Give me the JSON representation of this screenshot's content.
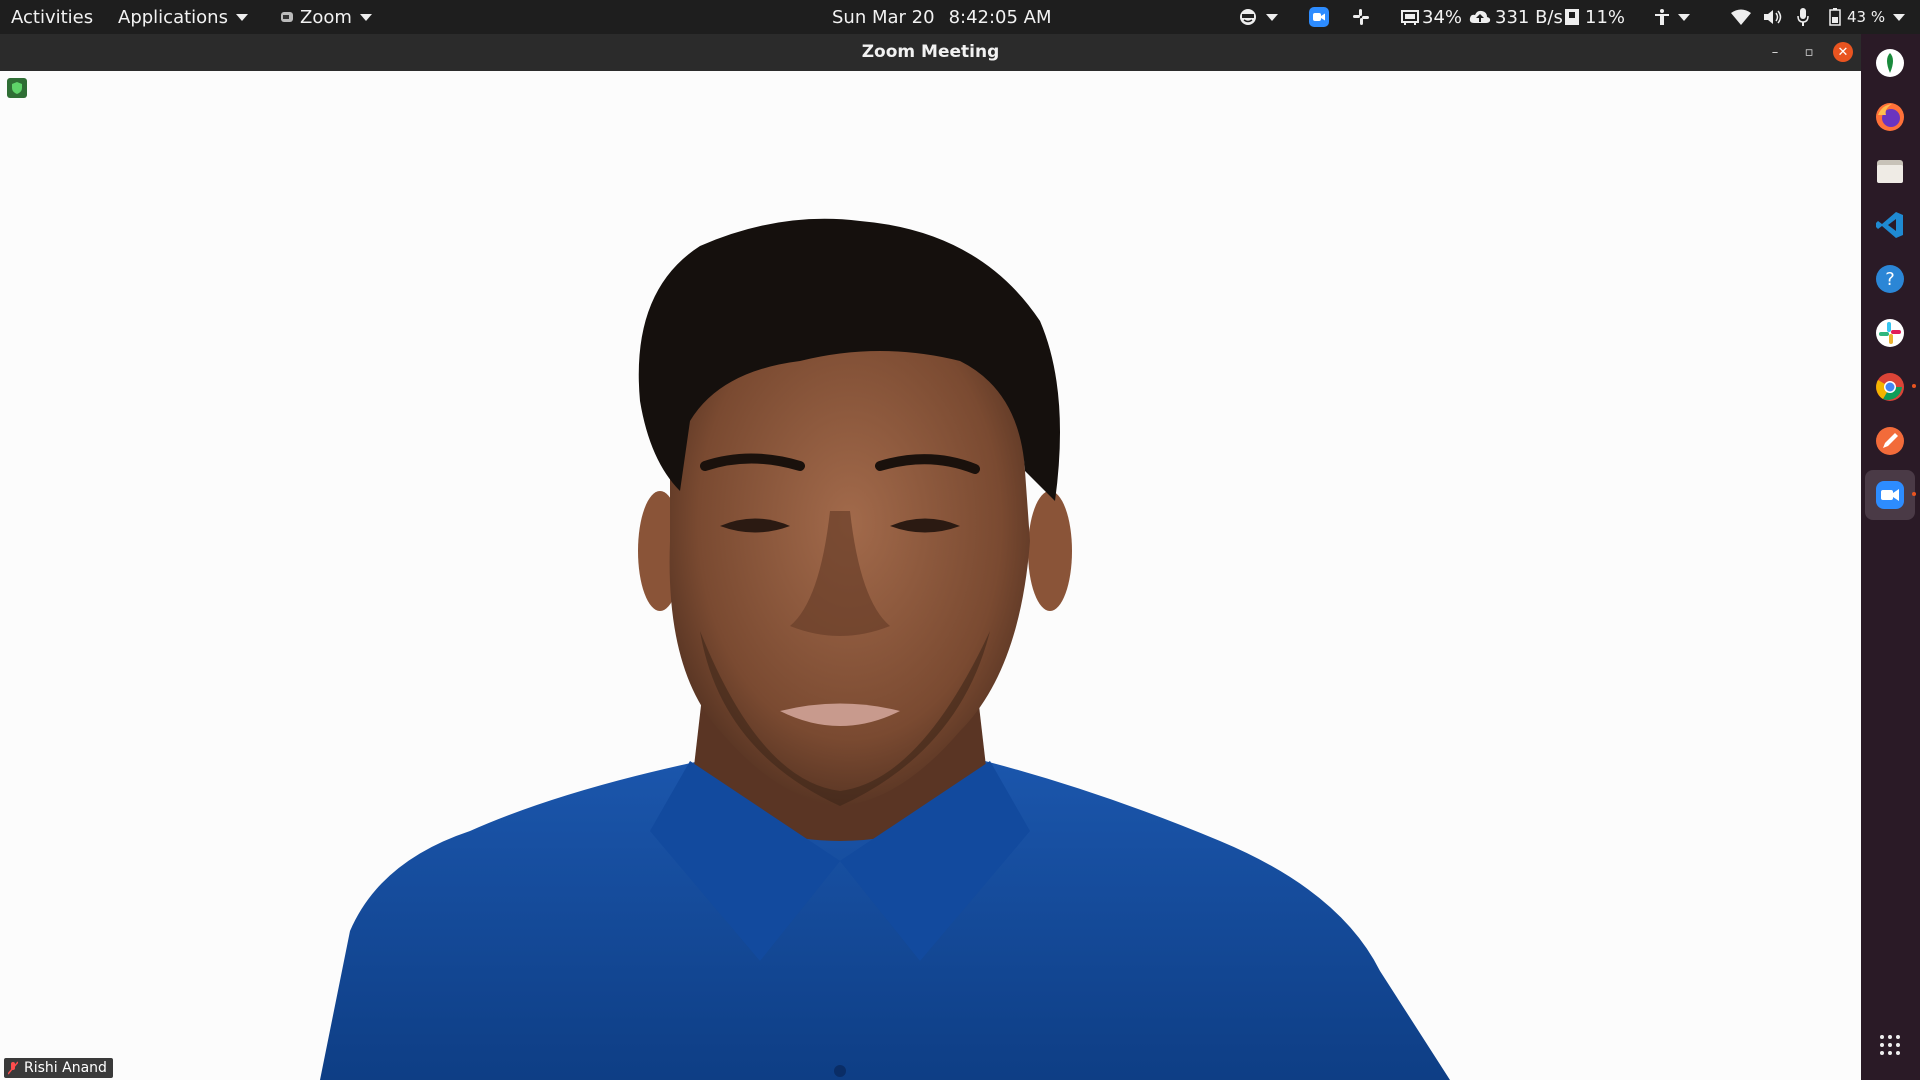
{
  "topbar": {
    "activities": "Activities",
    "applications": "Applications",
    "app_menu": "Zoom",
    "date": "Sun Mar 20",
    "time": "8:42:05 AM",
    "cpu": "34%",
    "net_speed": "331 B/s",
    "memory": "11%",
    "battery": "43 %"
  },
  "window": {
    "title": "Zoom Meeting",
    "minimize": "–",
    "restore": "▫",
    "close": "✕"
  },
  "meeting": {
    "participant_name": "Rishi Anand",
    "mic_muted": true,
    "secure_icon": "shield-icon"
  },
  "dock": {
    "items": [
      {
        "name": "dock-item-map-app",
        "icon": "map-pin-icon"
      },
      {
        "name": "dock-item-firefox",
        "icon": "firefox-icon"
      },
      {
        "name": "dock-item-files",
        "icon": "folder-icon"
      },
      {
        "name": "dock-item-vscode",
        "icon": "vscode-icon"
      },
      {
        "name": "dock-item-help",
        "icon": "help-icon"
      },
      {
        "name": "dock-item-slack",
        "icon": "slack-icon"
      },
      {
        "name": "dock-item-chrome",
        "icon": "chrome-icon"
      },
      {
        "name": "dock-item-editor",
        "icon": "pen-icon"
      },
      {
        "name": "dock-item-zoom",
        "icon": "zoom-camera-icon"
      },
      {
        "name": "dock-show-applications",
        "icon": "grid-icon"
      }
    ]
  },
  "colors": {
    "accent": "#e95420",
    "zoom_blue": "#2d8cff",
    "shirt_blue": "#14499b",
    "panel_bg": "#1e1e1e",
    "dock_bg": "#2a1a26"
  }
}
